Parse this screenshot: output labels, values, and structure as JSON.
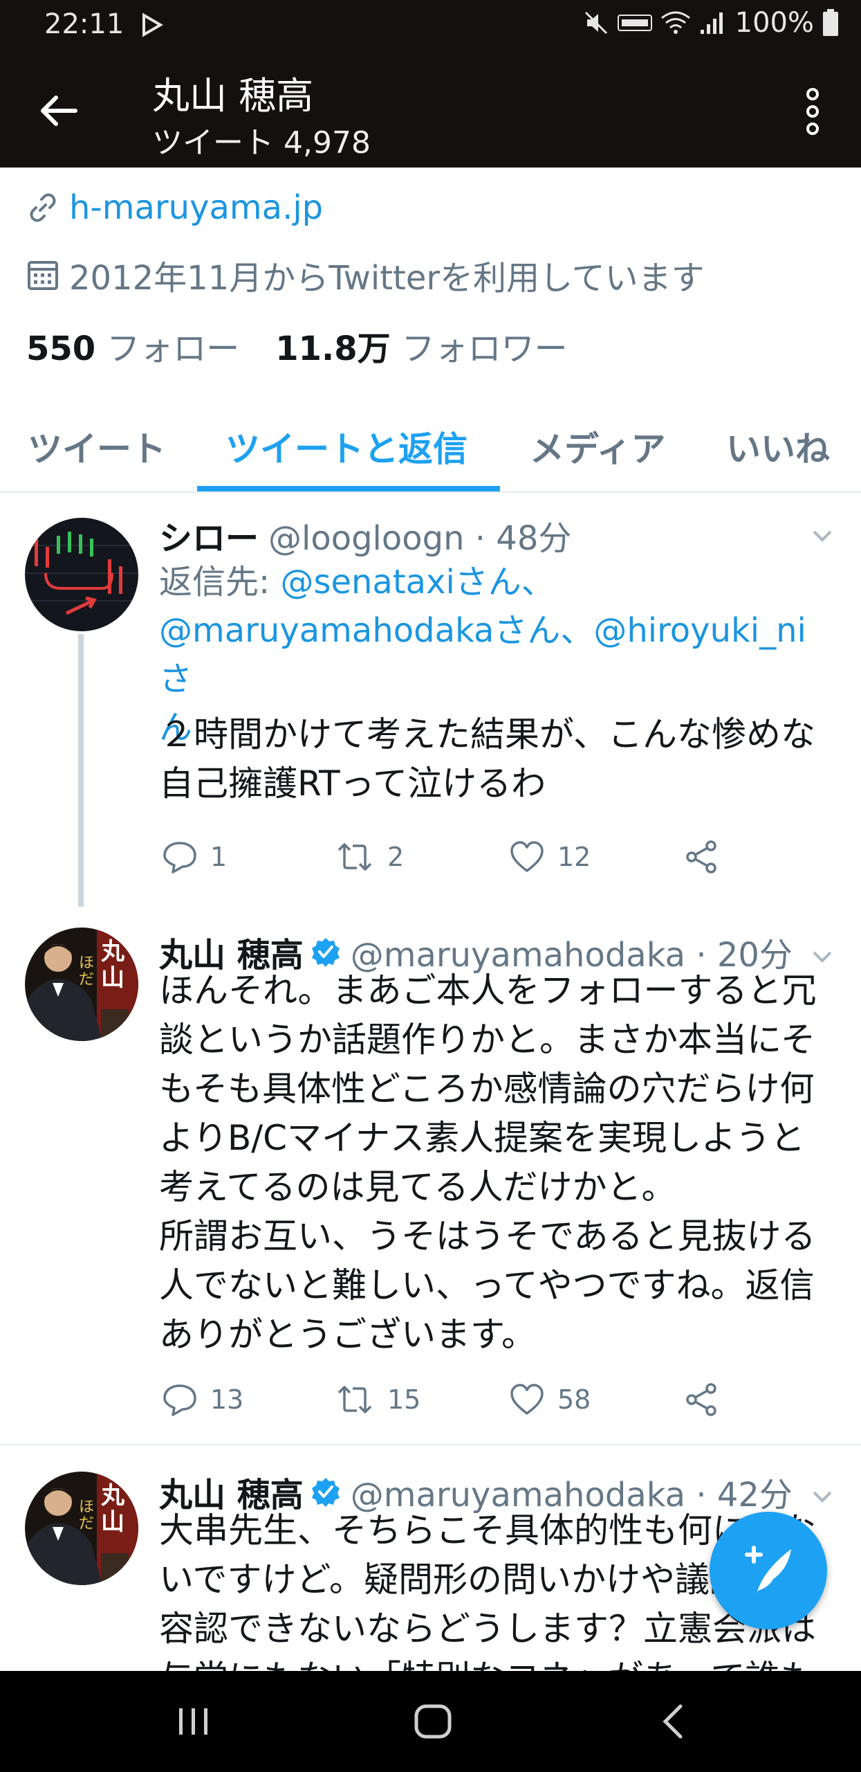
{
  "status_bar": {
    "time": "22:11",
    "battery": "100%"
  },
  "header": {
    "name": "丸山 穂高",
    "tweet_count_label": "ツイート 4,978"
  },
  "profile": {
    "link": "h-maruyama.jp",
    "joined": "2012年11月からTwitterを利用しています",
    "following_count": "550",
    "following_label": "フォロー",
    "followers_count": "11.8万",
    "followers_label": "フォロワー"
  },
  "tabs": [
    {
      "label": "ツイート"
    },
    {
      "label": "ツイートと返信",
      "active": true
    },
    {
      "label": "メディア"
    },
    {
      "label": "いいね"
    }
  ],
  "tweets": [
    {
      "name": "シロー",
      "handle": "@loogloogn · 48分",
      "reply_prefix": "返信先: ",
      "reply_mention_1": "@senataxiさん、",
      "reply_mention_2": "@maruyamahodakaさん、@hiroyuki_niさ",
      "reply_mention_3": "ん",
      "text": "２時間かけて考えた結果が、こんな惨めな\n自己擁護RTって泣けるわ",
      "replies": "1",
      "retweets": "2",
      "likes": "12"
    },
    {
      "name": "丸山 穂高",
      "handle": "@maruyamahodaka · 20分",
      "verified": true,
      "text": "ほんそれ。まあご本人をフォローすると冗\n談というか話題作りかと。まさか本当にそ\nもそも具体性どころか感情論の穴だらけ何\nよりB/Cマイナス素人提案を実現しようと\n考えてるのは見てる人だけかと。\n所謂お互い、うそはうそであると見抜ける\n人でないと難しい、ってやつですね。返信\nありがとうございます。",
      "replies": "13",
      "retweets": "15",
      "likes": "58"
    },
    {
      "name": "丸山 穂高",
      "handle": "@maruyamahodaka · 42分",
      "verified": true,
      "text": "大串先生、そちらこそ具体的性も何にもな\nいですけど。疑問形の問いかけや議論すら\n容認できないならどうします？立憲会派は\n与党にもない「特別なコネ」があって誰も"
    }
  ],
  "colors": {
    "accent": "#1da1f2",
    "link": "#1b95e0",
    "muted": "#657786",
    "header_bg": "#14100f"
  },
  "icons": {
    "back": "arrow-left-icon",
    "more": "more-vertical-icon",
    "link": "link-icon",
    "calendar": "calendar-icon",
    "reply": "reply-icon",
    "retweet": "retweet-icon",
    "like": "heart-icon",
    "share": "share-icon",
    "compose": "compose-icon"
  }
}
